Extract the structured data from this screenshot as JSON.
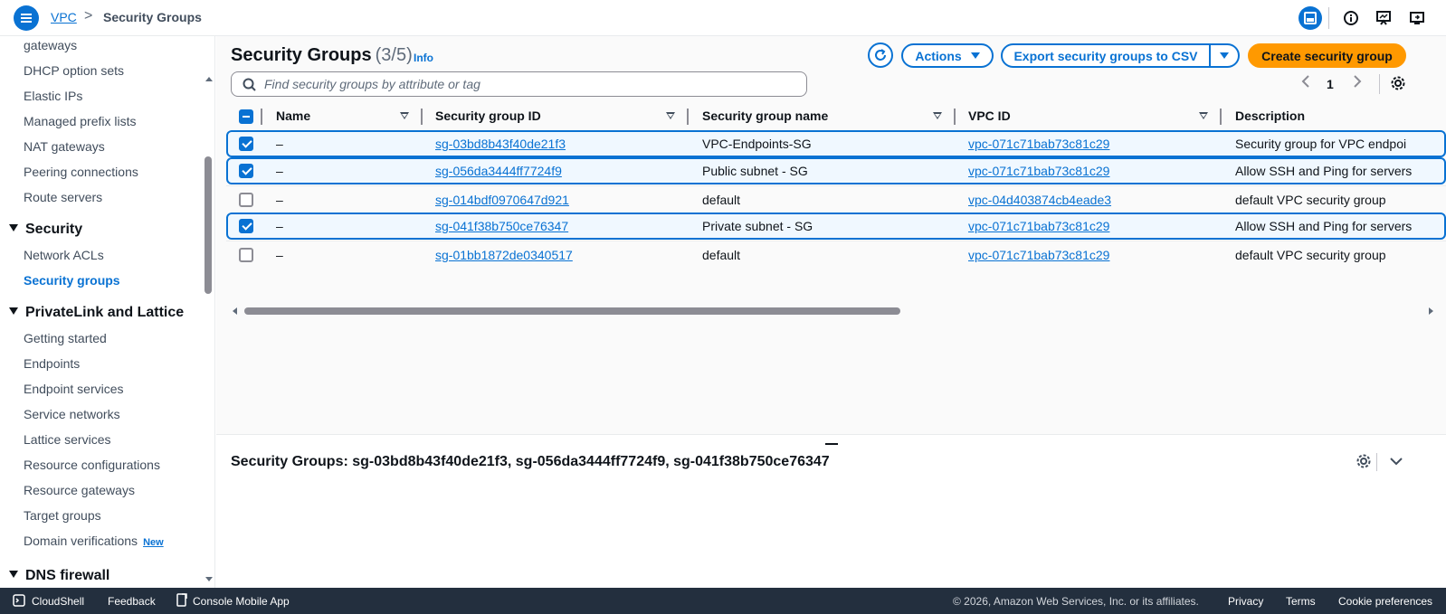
{
  "breadcrumb": {
    "root": "VPC",
    "separator": ">",
    "current": "Security Groups"
  },
  "sidebar": {
    "top_items": [
      "gateways",
      "DHCP option sets",
      "Elastic IPs",
      "Managed prefix lists",
      "NAT gateways",
      "Peering connections",
      "Route servers"
    ],
    "security_section": "Security",
    "security_items": [
      "Network ACLs",
      "Security groups"
    ],
    "privatelink_section": "PrivateLink and Lattice",
    "privatelink_items": [
      "Getting started",
      "Endpoints",
      "Endpoint services",
      "Service networks",
      "Lattice services",
      "Resource configurations",
      "Resource gateways",
      "Target groups",
      "Domain verifications"
    ],
    "new_badge": "New",
    "dns_section": "DNS firewall"
  },
  "header": {
    "title": "Security Groups",
    "count": "(3/5)",
    "info": "Info",
    "actions": "Actions",
    "export": "Export security groups to CSV",
    "create": "Create security group",
    "search_placeholder": "Find security groups by attribute or tag",
    "page": "1"
  },
  "table": {
    "columns": [
      "Name",
      "Security group ID",
      "Security group name",
      "VPC ID",
      "Description"
    ],
    "rows": [
      {
        "selected": true,
        "name": "–",
        "sg_id": "sg-03bd8b43f40de21f3",
        "sg_name": "VPC-Endpoints-SG",
        "vpc_id": "vpc-071c71bab73c81c29",
        "description": "Security group for VPC endpoi"
      },
      {
        "selected": true,
        "name": "–",
        "sg_id": "sg-056da3444ff7724f9",
        "sg_name": "Public subnet - SG",
        "vpc_id": "vpc-071c71bab73c81c29",
        "description": "Allow SSH and Ping for servers"
      },
      {
        "selected": false,
        "name": "–",
        "sg_id": "sg-014bdf0970647d921",
        "sg_name": "default",
        "vpc_id": "vpc-04d403874cb4eade3",
        "description": "default VPC security group"
      },
      {
        "selected": true,
        "name": "–",
        "sg_id": "sg-041f38b750ce76347",
        "sg_name": "Private subnet - SG",
        "vpc_id": "vpc-071c71bab73c81c29",
        "description": "Allow SSH and Ping for servers"
      },
      {
        "selected": false,
        "name": "–",
        "sg_id": "sg-01bb1872de0340517",
        "sg_name": "default",
        "vpc_id": "vpc-071c71bab73c81c29",
        "description": "default VPC security group"
      }
    ]
  },
  "split_panel": {
    "title": "Security Groups: sg-03bd8b43f40de21f3, sg-056da3444ff7724f9, sg-041f38b750ce76347"
  },
  "footer": {
    "cloudshell": "CloudShell",
    "feedback": "Feedback",
    "mobile_app": "Console Mobile App",
    "copyright": "© 2026, Amazon Web Services, Inc. or its affiliates.",
    "privacy": "Privacy",
    "terms": "Terms",
    "cookies": "Cookie preferences"
  },
  "colors": {
    "accent": "#0972d3",
    "primary_button": "#ff9900",
    "footer_bg": "#232f3e"
  }
}
